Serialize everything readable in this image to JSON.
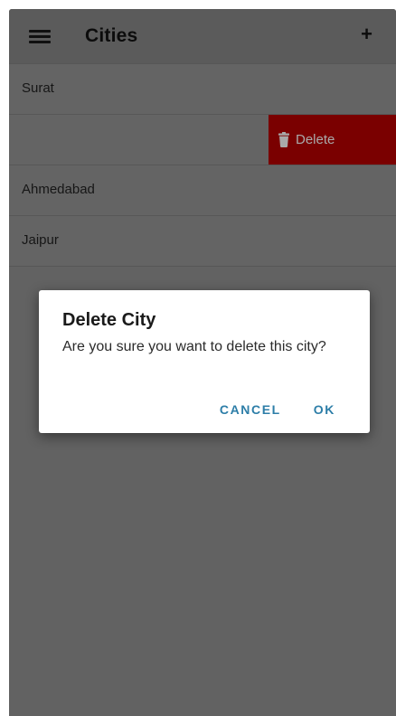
{
  "app_bar": {
    "title": "Cities",
    "menu_icon": "hamburger-menu-icon",
    "add_label": "+"
  },
  "cities": [
    {
      "name": "Surat"
    },
    {
      "name": ""
    },
    {
      "name": "Ahmedabad"
    },
    {
      "name": "Jaipur"
    }
  ],
  "swipe_action": {
    "label": "Delete",
    "icon": "trash-icon",
    "color": "#7a0000"
  },
  "dialog": {
    "title": "Delete City",
    "message": "Are you sure you want to delete this city?",
    "cancel_label": "CANCEL",
    "ok_label": "OK",
    "button_color": "#2d7ea8"
  },
  "colors": {
    "scrim": "#626262",
    "dialog_background": "#ffffff"
  }
}
